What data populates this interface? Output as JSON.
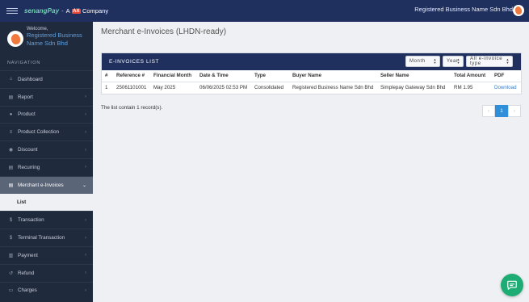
{
  "topbar": {
    "brand_name": "senangPay",
    "brand_separator": "-",
    "brand_company_prefix": "A",
    "brand_company_mark": "AX",
    "brand_company_suffix": "Company",
    "user_name": "Registered Business Name Sdn Bhd"
  },
  "sidebar": {
    "welcome": "Welcome,",
    "profile_name": "Registered Business Name Sdn Bhd",
    "nav_heading": "NAVIGATION",
    "items": [
      {
        "label": "Dashboard",
        "icon": "home-icon"
      },
      {
        "label": "Report",
        "icon": "calendar-icon"
      },
      {
        "label": "Product",
        "icon": "user-icon"
      },
      {
        "label": "Product Collection",
        "icon": "list-icon"
      },
      {
        "label": "Discount",
        "icon": "tag-icon"
      },
      {
        "label": "Recurring",
        "icon": "calendar-icon"
      },
      {
        "label": "Merchant e-Invoices",
        "icon": "calendar-icon"
      },
      {
        "label": "List"
      },
      {
        "label": "Transaction",
        "icon": "dollar-icon"
      },
      {
        "label": "Terminal Transaction",
        "icon": "dollar-icon"
      },
      {
        "label": "Payment",
        "icon": "bank-icon"
      },
      {
        "label": "Refund",
        "icon": "refund-icon"
      },
      {
        "label": "Charges",
        "icon": "card-icon"
      }
    ]
  },
  "main": {
    "title": "Merchant e-Invoices (LHDN-ready)",
    "card_title": "E-INVOICES LIST",
    "filters": {
      "month": "Month",
      "year": "Year",
      "type": "All e-invoice type"
    },
    "table": {
      "headers": [
        "#",
        "Reference #",
        "Financial Month",
        "Date & Time",
        "Type",
        "Buyer Name",
        "Seller Name",
        "Total Amount",
        "PDF"
      ],
      "rows": [
        [
          "1",
          "25061101001",
          "May 2025",
          "06/06/2025 02:53 PM",
          "Consolidated",
          "Registered Business Name Sdn Bhd",
          "Simplepay Gateway Sdn Bhd",
          "RM 1.95",
          "Download"
        ]
      ]
    },
    "record_count": "The list contain 1 record(s).",
    "pagination": {
      "prev": "‹",
      "current": "1",
      "next": "›"
    }
  },
  "colors": {
    "topbar": "#1f2f5e",
    "sidebar": "#202a3d",
    "accent_green": "#1dac74",
    "link_blue": "#2d7fd3"
  }
}
